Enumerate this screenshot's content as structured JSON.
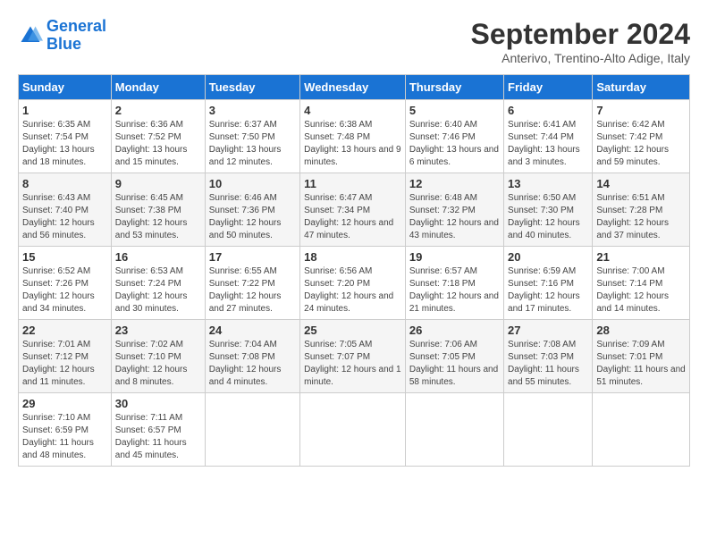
{
  "logo": {
    "line1": "General",
    "line2": "Blue"
  },
  "title": "September 2024",
  "subtitle": "Anterivo, Trentino-Alto Adige, Italy",
  "days_header": [
    "Sunday",
    "Monday",
    "Tuesday",
    "Wednesday",
    "Thursday",
    "Friday",
    "Saturday"
  ],
  "weeks": [
    [
      {
        "day": "1",
        "info": "Sunrise: 6:35 AM\nSunset: 7:54 PM\nDaylight: 13 hours and 18 minutes."
      },
      {
        "day": "2",
        "info": "Sunrise: 6:36 AM\nSunset: 7:52 PM\nDaylight: 13 hours and 15 minutes."
      },
      {
        "day": "3",
        "info": "Sunrise: 6:37 AM\nSunset: 7:50 PM\nDaylight: 13 hours and 12 minutes."
      },
      {
        "day": "4",
        "info": "Sunrise: 6:38 AM\nSunset: 7:48 PM\nDaylight: 13 hours and 9 minutes."
      },
      {
        "day": "5",
        "info": "Sunrise: 6:40 AM\nSunset: 7:46 PM\nDaylight: 13 hours and 6 minutes."
      },
      {
        "day": "6",
        "info": "Sunrise: 6:41 AM\nSunset: 7:44 PM\nDaylight: 13 hours and 3 minutes."
      },
      {
        "day": "7",
        "info": "Sunrise: 6:42 AM\nSunset: 7:42 PM\nDaylight: 12 hours and 59 minutes."
      }
    ],
    [
      {
        "day": "8",
        "info": "Sunrise: 6:43 AM\nSunset: 7:40 PM\nDaylight: 12 hours and 56 minutes."
      },
      {
        "day": "9",
        "info": "Sunrise: 6:45 AM\nSunset: 7:38 PM\nDaylight: 12 hours and 53 minutes."
      },
      {
        "day": "10",
        "info": "Sunrise: 6:46 AM\nSunset: 7:36 PM\nDaylight: 12 hours and 50 minutes."
      },
      {
        "day": "11",
        "info": "Sunrise: 6:47 AM\nSunset: 7:34 PM\nDaylight: 12 hours and 47 minutes."
      },
      {
        "day": "12",
        "info": "Sunrise: 6:48 AM\nSunset: 7:32 PM\nDaylight: 12 hours and 43 minutes."
      },
      {
        "day": "13",
        "info": "Sunrise: 6:50 AM\nSunset: 7:30 PM\nDaylight: 12 hours and 40 minutes."
      },
      {
        "day": "14",
        "info": "Sunrise: 6:51 AM\nSunset: 7:28 PM\nDaylight: 12 hours and 37 minutes."
      }
    ],
    [
      {
        "day": "15",
        "info": "Sunrise: 6:52 AM\nSunset: 7:26 PM\nDaylight: 12 hours and 34 minutes."
      },
      {
        "day": "16",
        "info": "Sunrise: 6:53 AM\nSunset: 7:24 PM\nDaylight: 12 hours and 30 minutes."
      },
      {
        "day": "17",
        "info": "Sunrise: 6:55 AM\nSunset: 7:22 PM\nDaylight: 12 hours and 27 minutes."
      },
      {
        "day": "18",
        "info": "Sunrise: 6:56 AM\nSunset: 7:20 PM\nDaylight: 12 hours and 24 minutes."
      },
      {
        "day": "19",
        "info": "Sunrise: 6:57 AM\nSunset: 7:18 PM\nDaylight: 12 hours and 21 minutes."
      },
      {
        "day": "20",
        "info": "Sunrise: 6:59 AM\nSunset: 7:16 PM\nDaylight: 12 hours and 17 minutes."
      },
      {
        "day": "21",
        "info": "Sunrise: 7:00 AM\nSunset: 7:14 PM\nDaylight: 12 hours and 14 minutes."
      }
    ],
    [
      {
        "day": "22",
        "info": "Sunrise: 7:01 AM\nSunset: 7:12 PM\nDaylight: 12 hours and 11 minutes."
      },
      {
        "day": "23",
        "info": "Sunrise: 7:02 AM\nSunset: 7:10 PM\nDaylight: 12 hours and 8 minutes."
      },
      {
        "day": "24",
        "info": "Sunrise: 7:04 AM\nSunset: 7:08 PM\nDaylight: 12 hours and 4 minutes."
      },
      {
        "day": "25",
        "info": "Sunrise: 7:05 AM\nSunset: 7:07 PM\nDaylight: 12 hours and 1 minute."
      },
      {
        "day": "26",
        "info": "Sunrise: 7:06 AM\nSunset: 7:05 PM\nDaylight: 11 hours and 58 minutes."
      },
      {
        "day": "27",
        "info": "Sunrise: 7:08 AM\nSunset: 7:03 PM\nDaylight: 11 hours and 55 minutes."
      },
      {
        "day": "28",
        "info": "Sunrise: 7:09 AM\nSunset: 7:01 PM\nDaylight: 11 hours and 51 minutes."
      }
    ],
    [
      {
        "day": "29",
        "info": "Sunrise: 7:10 AM\nSunset: 6:59 PM\nDaylight: 11 hours and 48 minutes."
      },
      {
        "day": "30",
        "info": "Sunrise: 7:11 AM\nSunset: 6:57 PM\nDaylight: 11 hours and 45 minutes."
      },
      {
        "day": "",
        "info": ""
      },
      {
        "day": "",
        "info": ""
      },
      {
        "day": "",
        "info": ""
      },
      {
        "day": "",
        "info": ""
      },
      {
        "day": "",
        "info": ""
      }
    ]
  ]
}
